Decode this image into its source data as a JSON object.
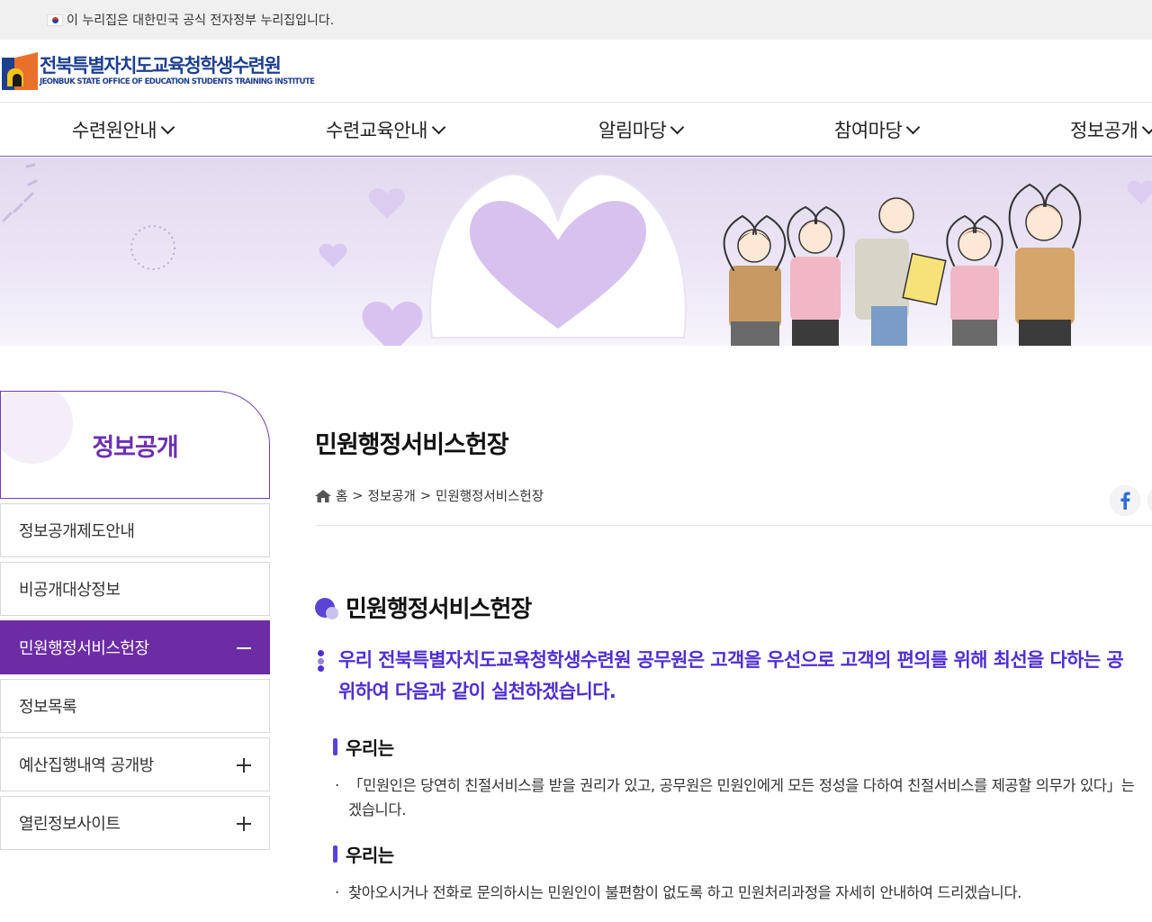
{
  "gov_banner": {
    "text": "이 누리집은 대한민국 공식 전자정부 누리집입니다."
  },
  "logo": {
    "name_ko": "전북특별자치도교육청학생수련원",
    "name_en": "JEONBUK STATE OFFICE OF EDUCATION STUDENTS TRAINING INSTITUTE"
  },
  "gnb": [
    "수련원안내",
    "수련교육안내",
    "알림마당",
    "참여마당",
    "정보공개"
  ],
  "sidebar": {
    "title": "정보공개",
    "items": [
      {
        "label": "정보공개제도안내",
        "active": false,
        "toggle": "none"
      },
      {
        "label": "비공개대상정보",
        "active": false,
        "toggle": "none"
      },
      {
        "label": "민원행정서비스헌장",
        "active": true,
        "toggle": "minus"
      },
      {
        "label": "정보목록",
        "active": false,
        "toggle": "none"
      },
      {
        "label": "예산집행내역 공개방",
        "active": false,
        "toggle": "plus"
      },
      {
        "label": "열린정보사이트",
        "active": false,
        "toggle": "plus"
      }
    ]
  },
  "content": {
    "page_title": "민원행정서비스헌장",
    "breadcrumb": [
      "홈",
      ">",
      "정보공개",
      ">",
      "민원행정서비스헌장"
    ],
    "section_title": "민원행정서비스헌장",
    "lead_line1": "우리 전북특별자치도교육청학생수련원 공무원은 고객을 우선으로 고객의 편의를 위해 최선을 다하는 공",
    "lead_line2": "위하여 다음과 같이 실천하겠습니다.",
    "blocks": [
      {
        "heading": "우리는",
        "lines": [
          "「민원인은 당연히 친절서비스를 받을 권리가 있고, 공무원은 민원인에게 모든 정성을 다하여 친절서비스를 제공할 의무가 있다」는",
          "겠습니다."
        ]
      },
      {
        "heading": "우리는",
        "lines": [
          "찾아오시거나 전화로 문의하시는 민원인이 불편함이 없도록 하고 민원처리과정을 자세히 안내하여 드리겠습니다."
        ]
      }
    ]
  },
  "colors": {
    "brand_purple": "#6c2ca6",
    "accent_blue": "#4f2fd0",
    "logo_navy": "#1d3f8f"
  }
}
